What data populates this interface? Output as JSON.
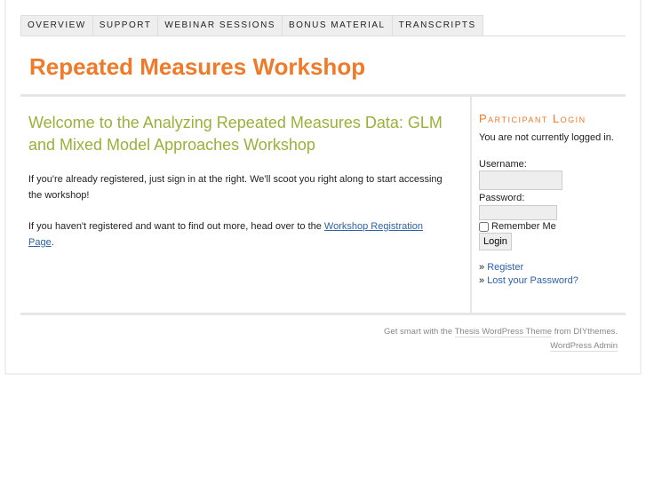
{
  "nav": [
    "Overview",
    "Support",
    "Webinar Sessions",
    "Bonus Material",
    "Transcripts"
  ],
  "title": "Repeated Measures Workshop",
  "main": {
    "heading": "Welcome to the Analyzing Repeated Measures Data: GLM and Mixed Model Approaches Workshop",
    "p1": "If you're already registered, just sign in at the right. We'll scoot you right along to start accessing the workshop!",
    "p2_pre": "If you haven't registered and want to find out more, head over to the ",
    "p2_link": "Workshop Registration Page",
    "p2_post": "."
  },
  "sidebar": {
    "title": "Participant Login",
    "status": "You are not currently logged in.",
    "username_label": "Username:",
    "username_value": "",
    "password_label": "Password:",
    "password_value": "",
    "remember": "Remember Me",
    "login": "Login",
    "bullet": "»",
    "register": "Register",
    "lost": "Lost your Password?"
  },
  "footer": {
    "pre": "Get smart with the ",
    "theme_link": "Thesis WordPress Theme",
    "mid": " from DIYthemes.",
    "admin": "WordPress Admin"
  }
}
